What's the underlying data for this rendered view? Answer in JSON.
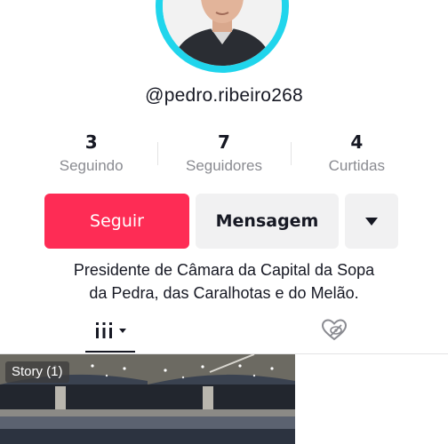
{
  "profile": {
    "username": "@pedro.ribeiro268",
    "bio_line1": "Presidente de Câmara da Capital da Sopa",
    "bio_line2": "da Pedra, das Caralhotas e do Melão."
  },
  "stats": [
    {
      "value": "3",
      "label": "Seguindo"
    },
    {
      "value": "7",
      "label": "Seguidores"
    },
    {
      "value": "4",
      "label": "Curtidas"
    }
  ],
  "actions": {
    "follow_label": "Seguir",
    "message_label": "Mensagem",
    "more_icon": "caret-down-icon"
  },
  "tabs": {
    "videos_icon": "grid-icon",
    "liked_icon": "private-heart-icon"
  },
  "grid": {
    "story_badge": "Story (1)"
  },
  "colors": {
    "accent": "#fe2c55",
    "ring": "#20d5ec",
    "secondary_bg": "#f1f1f2",
    "muted_text": "#8a8b91"
  }
}
